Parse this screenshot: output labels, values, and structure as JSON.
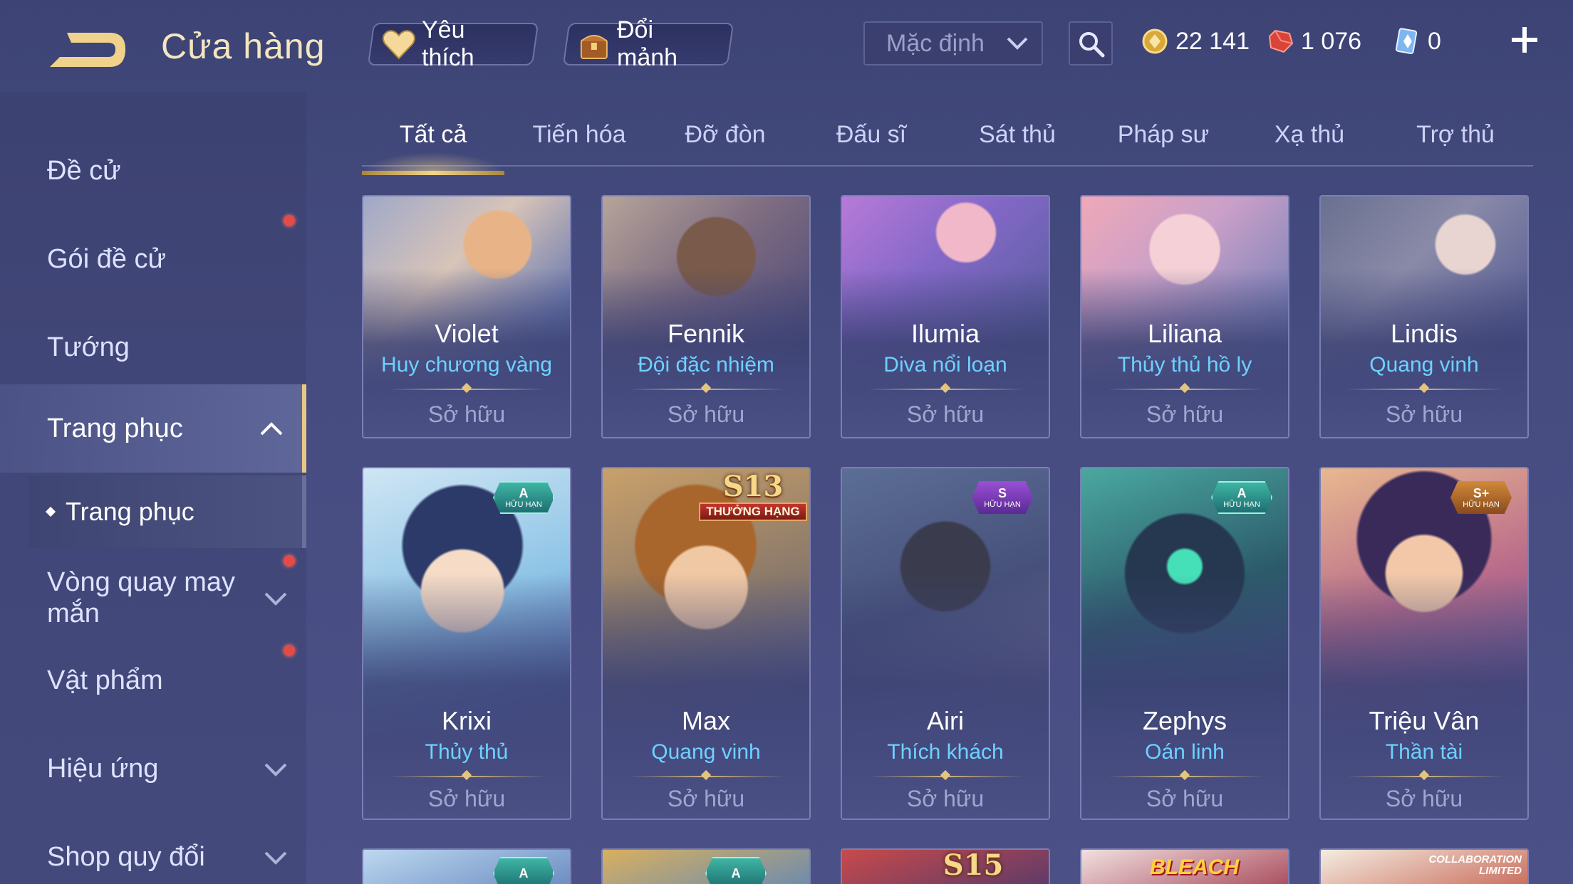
{
  "header": {
    "title": "Cửa hàng",
    "favorite_label": "Yêu thích",
    "shard_label": "Đổi mảnh",
    "sort_value": "Mặc định"
  },
  "currency": {
    "gold": "22 141",
    "voucher": "1 076",
    "crystal": "0"
  },
  "sidebar": {
    "items": [
      {
        "label": "Đề cử"
      },
      {
        "label": "Gói đề cử"
      },
      {
        "label": "Tướng"
      },
      {
        "label": "Trang phục"
      },
      {
        "label": "Vòng quay may mắn"
      },
      {
        "label": "Vật phẩm"
      },
      {
        "label": "Hiệu ứng"
      },
      {
        "label": "Shop quy đổi"
      }
    ],
    "sub_item": "Trang phục"
  },
  "tabs": [
    "Tất cả",
    "Tiến hóa",
    "Đỡ đòn",
    "Đấu sĩ",
    "Sát thủ",
    "Pháp sư",
    "Xạ thủ",
    "Trợ thủ"
  ],
  "cards_row1": [
    {
      "hero": "Violet",
      "skin": "Huy chương vàng",
      "status": "Sở hữu"
    },
    {
      "hero": "Fennik",
      "skin": "Đội đặc nhiệm",
      "status": "Sở hữu"
    },
    {
      "hero": "Ilumia",
      "skin": "Diva nổi loạn",
      "status": "Sở hữu"
    },
    {
      "hero": "Liliana",
      "skin": "Thủy thủ hồ ly",
      "status": "Sở hữu"
    },
    {
      "hero": "Lindis",
      "skin": "Quang vinh",
      "status": "Sở hữu"
    }
  ],
  "cards_row2": [
    {
      "hero": "Krixi",
      "skin": "Thủy thủ",
      "status": "Sở hữu",
      "badge_grade": "A",
      "badge_label": "HỮU HẠN"
    },
    {
      "hero": "Max",
      "skin": "Quang vinh",
      "status": "Sở hữu",
      "season": "S13",
      "season_label": "THƯỞNG HẠNG"
    },
    {
      "hero": "Airi",
      "skin": "Thích khách",
      "status": "Sở hữu",
      "badge_grade": "S",
      "badge_label": "HỮU HẠN"
    },
    {
      "hero": "Zephys",
      "skin": "Oán linh",
      "status": "Sở hữu",
      "badge_grade": "A",
      "badge_label": "HỮU HẠN"
    },
    {
      "hero": "Triệu Vân",
      "skin": "Thần tài",
      "status": "Sở hữu",
      "badge_grade": "S+",
      "badge_label": "HỮU HẠN"
    }
  ],
  "cards_row3": {
    "badge_a": "A",
    "season": "S15",
    "bleach": "BLEACH",
    "collab": "COLLABORATION LIMITED"
  },
  "colors": {
    "accent_gold": "#e8c886",
    "skin_name_blue": "#6ed1ff",
    "notification_red": "#e24b47"
  }
}
